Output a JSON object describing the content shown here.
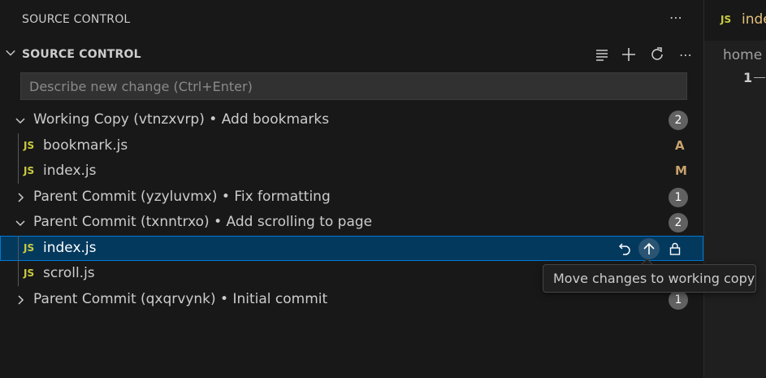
{
  "panel": {
    "title": "SOURCE CONTROL",
    "more_glyph": "⋯"
  },
  "section": {
    "title": "SOURCE CONTROL",
    "actions": [
      "list-icon",
      "plus-icon",
      "refresh-icon",
      "more-icon"
    ],
    "more_glyph": "⋯"
  },
  "input": {
    "placeholder": "Describe new change (Ctrl+Enter)",
    "value": ""
  },
  "groups": [
    {
      "label": "Working Copy (vtnzxvrp) • Add bookmarks",
      "badge": "2",
      "expanded": true
    },
    {
      "label": "Parent Commit (yzyluvmx) • Fix formatting",
      "badge": "1",
      "expanded": false
    },
    {
      "label": "Parent Commit (txnntrxo) • Add scrolling to page",
      "badge": "2",
      "expanded": true
    },
    {
      "label": "Parent Commit (qxqrvynk) • Initial commit",
      "badge": "1",
      "expanded": false
    }
  ],
  "files": [
    {
      "icon": "JS",
      "name": "bookmark.js",
      "status": "A",
      "status_color": "#c9a26d"
    },
    {
      "icon": "JS",
      "name": "index.js",
      "status": "M",
      "status_color": "#c9a26d"
    },
    {
      "icon": "JS",
      "name": "index.js",
      "status": "",
      "selected": true
    },
    {
      "icon": "JS",
      "name": "scroll.js",
      "status": ""
    }
  ],
  "row_actions": [
    "discard-icon",
    "arrow-up-icon",
    "lock-icon"
  ],
  "tooltip": {
    "text": "Move changes to working copy"
  },
  "editor": {
    "tab_icon": "JS",
    "tab_name": "index.js",
    "breadcrumb": "home",
    "line_number": "1"
  },
  "colors": {
    "accent": "#0078d4",
    "selection": "#04395e",
    "badge": "#616161",
    "js_icon": "#cbcb41",
    "modified": "#c9a26d"
  }
}
